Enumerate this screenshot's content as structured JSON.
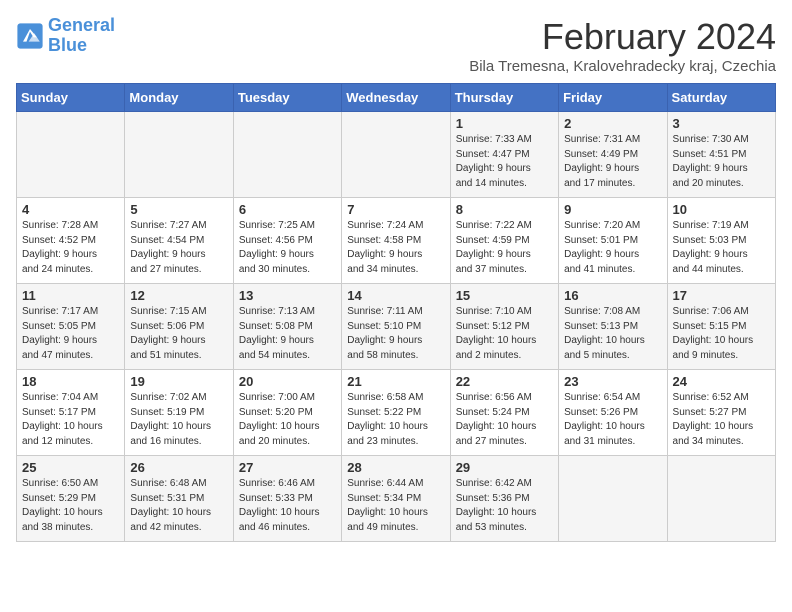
{
  "header": {
    "logo_line1": "General",
    "logo_line2": "Blue",
    "title": "February 2024",
    "subtitle": "Bila Tremesna, Kralovehradecky kraj, Czechia"
  },
  "weekdays": [
    "Sunday",
    "Monday",
    "Tuesday",
    "Wednesday",
    "Thursday",
    "Friday",
    "Saturday"
  ],
  "weeks": [
    [
      {
        "day": "",
        "info": ""
      },
      {
        "day": "",
        "info": ""
      },
      {
        "day": "",
        "info": ""
      },
      {
        "day": "",
        "info": ""
      },
      {
        "day": "1",
        "info": "Sunrise: 7:33 AM\nSunset: 4:47 PM\nDaylight: 9 hours\nand 14 minutes."
      },
      {
        "day": "2",
        "info": "Sunrise: 7:31 AM\nSunset: 4:49 PM\nDaylight: 9 hours\nand 17 minutes."
      },
      {
        "day": "3",
        "info": "Sunrise: 7:30 AM\nSunset: 4:51 PM\nDaylight: 9 hours\nand 20 minutes."
      }
    ],
    [
      {
        "day": "4",
        "info": "Sunrise: 7:28 AM\nSunset: 4:52 PM\nDaylight: 9 hours\nand 24 minutes."
      },
      {
        "day": "5",
        "info": "Sunrise: 7:27 AM\nSunset: 4:54 PM\nDaylight: 9 hours\nand 27 minutes."
      },
      {
        "day": "6",
        "info": "Sunrise: 7:25 AM\nSunset: 4:56 PM\nDaylight: 9 hours\nand 30 minutes."
      },
      {
        "day": "7",
        "info": "Sunrise: 7:24 AM\nSunset: 4:58 PM\nDaylight: 9 hours\nand 34 minutes."
      },
      {
        "day": "8",
        "info": "Sunrise: 7:22 AM\nSunset: 4:59 PM\nDaylight: 9 hours\nand 37 minutes."
      },
      {
        "day": "9",
        "info": "Sunrise: 7:20 AM\nSunset: 5:01 PM\nDaylight: 9 hours\nand 41 minutes."
      },
      {
        "day": "10",
        "info": "Sunrise: 7:19 AM\nSunset: 5:03 PM\nDaylight: 9 hours\nand 44 minutes."
      }
    ],
    [
      {
        "day": "11",
        "info": "Sunrise: 7:17 AM\nSunset: 5:05 PM\nDaylight: 9 hours\nand 47 minutes."
      },
      {
        "day": "12",
        "info": "Sunrise: 7:15 AM\nSunset: 5:06 PM\nDaylight: 9 hours\nand 51 minutes."
      },
      {
        "day": "13",
        "info": "Sunrise: 7:13 AM\nSunset: 5:08 PM\nDaylight: 9 hours\nand 54 minutes."
      },
      {
        "day": "14",
        "info": "Sunrise: 7:11 AM\nSunset: 5:10 PM\nDaylight: 9 hours\nand 58 minutes."
      },
      {
        "day": "15",
        "info": "Sunrise: 7:10 AM\nSunset: 5:12 PM\nDaylight: 10 hours\nand 2 minutes."
      },
      {
        "day": "16",
        "info": "Sunrise: 7:08 AM\nSunset: 5:13 PM\nDaylight: 10 hours\nand 5 minutes."
      },
      {
        "day": "17",
        "info": "Sunrise: 7:06 AM\nSunset: 5:15 PM\nDaylight: 10 hours\nand 9 minutes."
      }
    ],
    [
      {
        "day": "18",
        "info": "Sunrise: 7:04 AM\nSunset: 5:17 PM\nDaylight: 10 hours\nand 12 minutes."
      },
      {
        "day": "19",
        "info": "Sunrise: 7:02 AM\nSunset: 5:19 PM\nDaylight: 10 hours\nand 16 minutes."
      },
      {
        "day": "20",
        "info": "Sunrise: 7:00 AM\nSunset: 5:20 PM\nDaylight: 10 hours\nand 20 minutes."
      },
      {
        "day": "21",
        "info": "Sunrise: 6:58 AM\nSunset: 5:22 PM\nDaylight: 10 hours\nand 23 minutes."
      },
      {
        "day": "22",
        "info": "Sunrise: 6:56 AM\nSunset: 5:24 PM\nDaylight: 10 hours\nand 27 minutes."
      },
      {
        "day": "23",
        "info": "Sunrise: 6:54 AM\nSunset: 5:26 PM\nDaylight: 10 hours\nand 31 minutes."
      },
      {
        "day": "24",
        "info": "Sunrise: 6:52 AM\nSunset: 5:27 PM\nDaylight: 10 hours\nand 34 minutes."
      }
    ],
    [
      {
        "day": "25",
        "info": "Sunrise: 6:50 AM\nSunset: 5:29 PM\nDaylight: 10 hours\nand 38 minutes."
      },
      {
        "day": "26",
        "info": "Sunrise: 6:48 AM\nSunset: 5:31 PM\nDaylight: 10 hours\nand 42 minutes."
      },
      {
        "day": "27",
        "info": "Sunrise: 6:46 AM\nSunset: 5:33 PM\nDaylight: 10 hours\nand 46 minutes."
      },
      {
        "day": "28",
        "info": "Sunrise: 6:44 AM\nSunset: 5:34 PM\nDaylight: 10 hours\nand 49 minutes."
      },
      {
        "day": "29",
        "info": "Sunrise: 6:42 AM\nSunset: 5:36 PM\nDaylight: 10 hours\nand 53 minutes."
      },
      {
        "day": "",
        "info": ""
      },
      {
        "day": "",
        "info": ""
      }
    ]
  ]
}
